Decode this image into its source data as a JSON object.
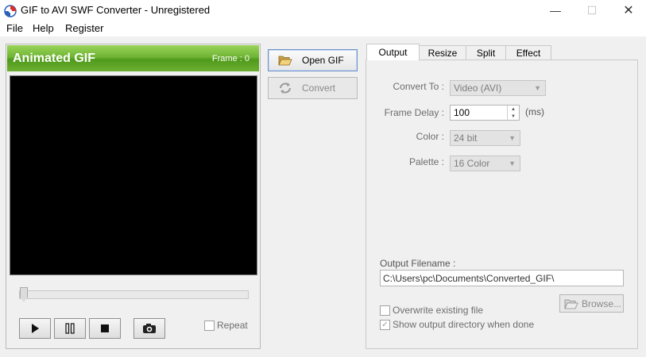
{
  "window": {
    "title": "GIF to AVI SWF Converter - Unregistered",
    "controls": {
      "minimize": "—",
      "maximize": "☐",
      "close": "✕"
    }
  },
  "menu": {
    "items": [
      "File",
      "Help",
      "Register"
    ]
  },
  "left": {
    "header_title": "Animated GIF",
    "frame_label": "Frame : 0",
    "repeat_label": "Repeat",
    "repeat_checked": false,
    "playback_icons": [
      "play-icon",
      "pause-icon",
      "stop-icon",
      "camera-icon"
    ]
  },
  "actions": {
    "open_label": "Open GIF",
    "convert_label": "Convert"
  },
  "tabs": [
    {
      "label": "Output",
      "active": true
    },
    {
      "label": "Resize",
      "active": false
    },
    {
      "label": "Split",
      "active": false
    },
    {
      "label": "Effect",
      "active": false
    }
  ],
  "output": {
    "convert_to_label": "Convert To :",
    "convert_to_value": "Video (AVI)",
    "frame_delay_label": "Frame Delay :",
    "frame_delay_value": "100",
    "frame_delay_unit": "(ms)",
    "color_label": "Color :",
    "color_value": "24 bit",
    "palette_label": "Palette :",
    "palette_value": "16 Color",
    "filename_label": "Output Filename :",
    "filename_value": "C:\\Users\\pc\\Documents\\Converted_GIF\\",
    "browse_label": "Browse...",
    "overwrite_label": "Overwrite existing file",
    "overwrite_checked": false,
    "show_dir_label": "Show output directory when done",
    "show_dir_checked": true
  },
  "colors": {
    "header_green": "#6fb434",
    "accent_blue": "#6c8fc7"
  }
}
